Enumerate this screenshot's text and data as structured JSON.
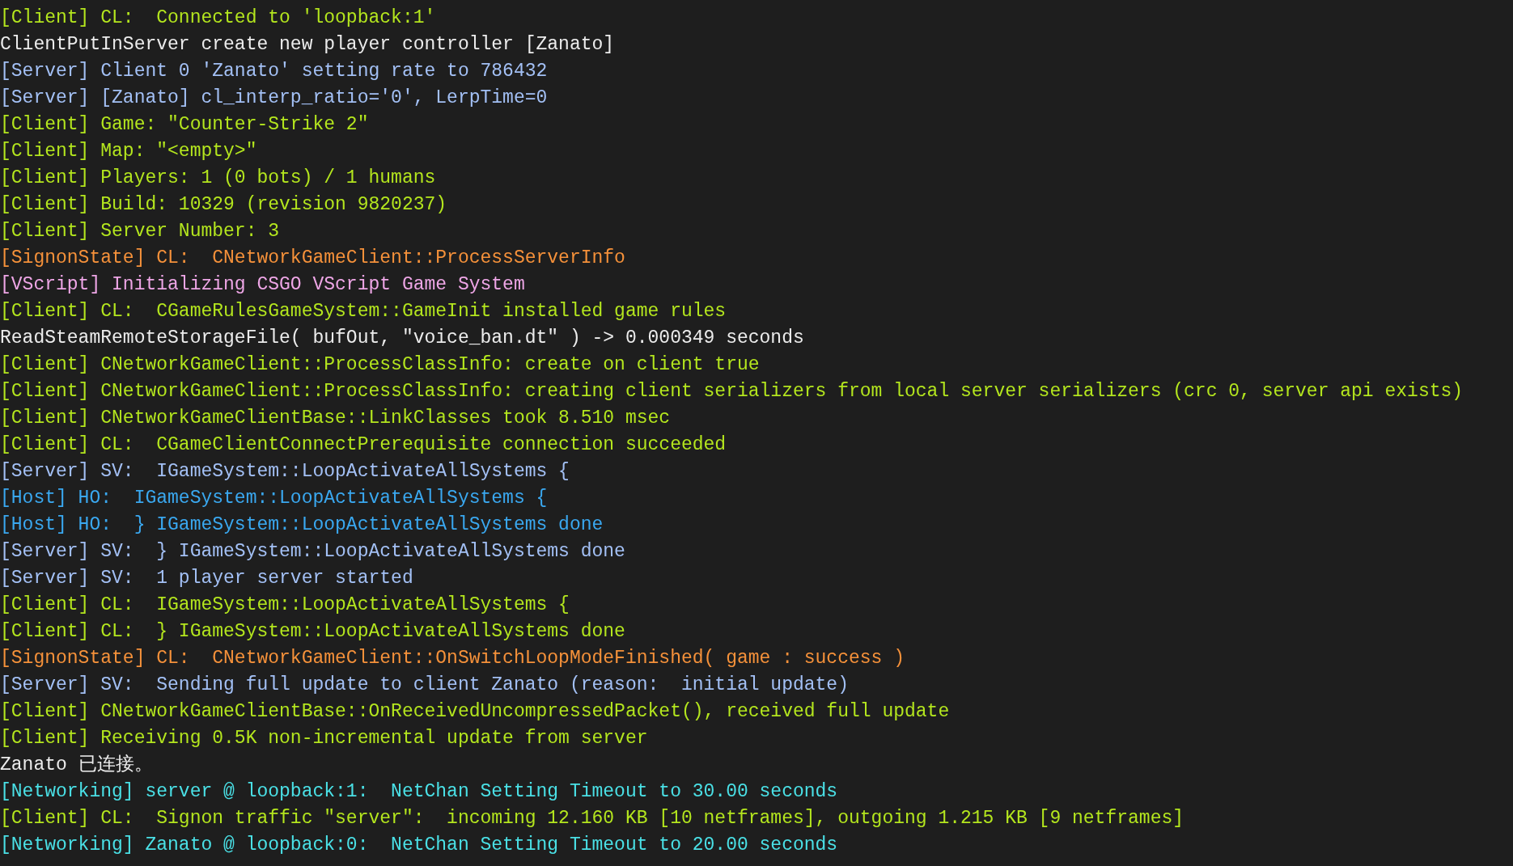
{
  "console": {
    "lines": [
      {
        "kind": "client",
        "text": "[Client] CL:  Connected to 'loopback:1'"
      },
      {
        "kind": "plain",
        "text": "ClientPutInServer create new player controller [Zanato]"
      },
      {
        "kind": "server",
        "text": "[Server] Client 0 'Zanato' setting rate to 786432"
      },
      {
        "kind": "server",
        "text": "[Server] [Zanato] cl_interp_ratio='0', LerpTime=0"
      },
      {
        "kind": "client",
        "text": "[Client] Game: \"Counter-Strike 2\""
      },
      {
        "kind": "client",
        "text": "[Client] Map: \"<empty>\""
      },
      {
        "kind": "client",
        "text": "[Client] Players: 1 (0 bots) / 1 humans"
      },
      {
        "kind": "client",
        "text": "[Client] Build: 10329 (revision 9820237)"
      },
      {
        "kind": "client",
        "text": "[Client] Server Number: 3"
      },
      {
        "kind": "signon",
        "text": "[SignonState] CL:  CNetworkGameClient::ProcessServerInfo"
      },
      {
        "kind": "vscript",
        "text": "[VScript] Initializing CSGO VScript Game System"
      },
      {
        "kind": "client",
        "text": "[Client] CL:  CGameRulesGameSystem::GameInit installed game rules"
      },
      {
        "kind": "plain",
        "text": "ReadSteamRemoteStorageFile( bufOut, \"voice_ban.dt\" ) -> 0.000349 seconds"
      },
      {
        "kind": "client",
        "text": "[Client] CNetworkGameClient::ProcessClassInfo: create on client true"
      },
      {
        "kind": "client",
        "text": "[Client] CNetworkGameClient::ProcessClassInfo: creating client serializers from local server serializers (crc 0, server api exists)"
      },
      {
        "kind": "client",
        "text": "[Client] CNetworkGameClientBase::LinkClasses took 8.510 msec"
      },
      {
        "kind": "client",
        "text": "[Client] CL:  CGameClientConnectPrerequisite connection succeeded"
      },
      {
        "kind": "server",
        "text": "[Server] SV:  IGameSystem::LoopActivateAllSystems {"
      },
      {
        "kind": "host",
        "text": "[Host] HO:  IGameSystem::LoopActivateAllSystems {"
      },
      {
        "kind": "host",
        "text": "[Host] HO:  } IGameSystem::LoopActivateAllSystems done"
      },
      {
        "kind": "server",
        "text": "[Server] SV:  } IGameSystem::LoopActivateAllSystems done"
      },
      {
        "kind": "server",
        "text": "[Server] SV:  1 player server started"
      },
      {
        "kind": "client",
        "text": "[Client] CL:  IGameSystem::LoopActivateAllSystems {"
      },
      {
        "kind": "client",
        "text": "[Client] CL:  } IGameSystem::LoopActivateAllSystems done"
      },
      {
        "kind": "signon",
        "text": "[SignonState] CL:  CNetworkGameClient::OnSwitchLoopModeFinished( game : success )"
      },
      {
        "kind": "server",
        "text": "[Server] SV:  Sending full update to client Zanato (reason:  initial update)"
      },
      {
        "kind": "client",
        "text": "[Client] CNetworkGameClientBase::OnReceivedUncompressedPacket(), received full update"
      },
      {
        "kind": "client",
        "text": "[Client] Receiving 0.5K non-incremental update from server"
      },
      {
        "kind": "plain",
        "text": "Zanato 已连接。"
      },
      {
        "kind": "networking",
        "text": "[Networking] server @ loopback:1:  NetChan Setting Timeout to 30.00 seconds"
      },
      {
        "kind": "client",
        "text": "[Client] CL:  Signon traffic \"server\":  incoming 12.160 KB [10 netframes], outgoing 1.215 KB [9 netframes]"
      },
      {
        "kind": "networking",
        "text": "[Networking] Zanato @ loopback:0:  NetChan Setting Timeout to 20.00 seconds"
      }
    ]
  }
}
